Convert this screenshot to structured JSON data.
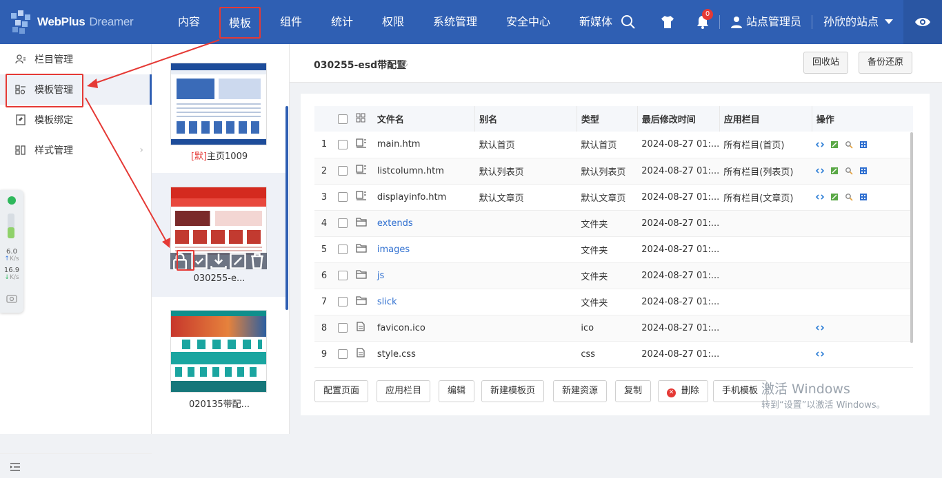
{
  "header": {
    "logo_primary": "WebPlus",
    "logo_secondary": "Dreamer",
    "nav": [
      "内容",
      "模板",
      "组件",
      "统计",
      "权限",
      "系统管理",
      "安全中心",
      "新媒体"
    ],
    "active_nav": "模板",
    "notification_count": "0",
    "user": "站点管理员",
    "site": "孙欣的站点",
    "colors": {
      "bar": "#2f5fb3",
      "highlight": "#e53935"
    }
  },
  "sidebar": {
    "items": [
      {
        "label": "栏目管理",
        "icon": "users-icon"
      },
      {
        "label": "模板管理",
        "icon": "template-icon"
      },
      {
        "label": "模板绑定",
        "icon": "bind-icon"
      },
      {
        "label": "样式管理",
        "icon": "style-icon"
      }
    ]
  },
  "speed_widget": {
    "up_value": "6.0",
    "up_unit": "K/s",
    "down_value": "16.9",
    "down_unit": "K/s"
  },
  "templates": [
    {
      "default_tag": "[默]",
      "name": "主页1009"
    },
    {
      "name": "030255-e..."
    },
    {
      "name": "020135带配..."
    }
  ],
  "main": {
    "title": "030255-esd带配置",
    "recycle_btn": "回收站",
    "backup_btn": "备份还原",
    "columns": [
      "文件名",
      "别名",
      "类型",
      "最后修改时间",
      "应用栏目",
      "操作"
    ],
    "rows": [
      {
        "no": "1",
        "name": "main.htm",
        "alias": "默认首页",
        "type": "默认首页",
        "time": "2024-08-27 01:...",
        "column": "所有栏目(首页)",
        "kind": "page"
      },
      {
        "no": "2",
        "name": "listcolumn.htm",
        "alias": "默认列表页",
        "type": "默认列表页",
        "time": "2024-08-27 01:...",
        "column": "所有栏目(列表页)",
        "kind": "page"
      },
      {
        "no": "3",
        "name": "displayinfo.htm",
        "alias": "默认文章页",
        "type": "默认文章页",
        "time": "2024-08-27 01:...",
        "column": "所有栏目(文章页)",
        "kind": "page"
      },
      {
        "no": "4",
        "name": "extends",
        "alias": "",
        "type": "文件夹",
        "time": "2024-08-27 01:...",
        "column": "",
        "kind": "folder"
      },
      {
        "no": "5",
        "name": "images",
        "alias": "",
        "type": "文件夹",
        "time": "2024-08-27 01:...",
        "column": "",
        "kind": "folder"
      },
      {
        "no": "6",
        "name": "js",
        "alias": "",
        "type": "文件夹",
        "time": "2024-08-27 01:...",
        "column": "",
        "kind": "folder"
      },
      {
        "no": "7",
        "name": "slick",
        "alias": "",
        "type": "文件夹",
        "time": "2024-08-27 01:...",
        "column": "",
        "kind": "folder"
      },
      {
        "no": "8",
        "name": "favicon.ico",
        "alias": "",
        "type": "ico",
        "time": "2024-08-27 01:...",
        "column": "",
        "kind": "file"
      },
      {
        "no": "9",
        "name": "style.css",
        "alias": "",
        "type": "css",
        "time": "2024-08-27 01:...",
        "column": "",
        "kind": "file"
      }
    ],
    "actions": [
      "配置页面",
      "应用栏目",
      "编辑",
      "新建模板页",
      "新建资源",
      "复制",
      "删除",
      "手机模板"
    ]
  },
  "watermark": {
    "line1": "激活 Windows",
    "line2": "转到“设置”以激活 Windows。"
  }
}
